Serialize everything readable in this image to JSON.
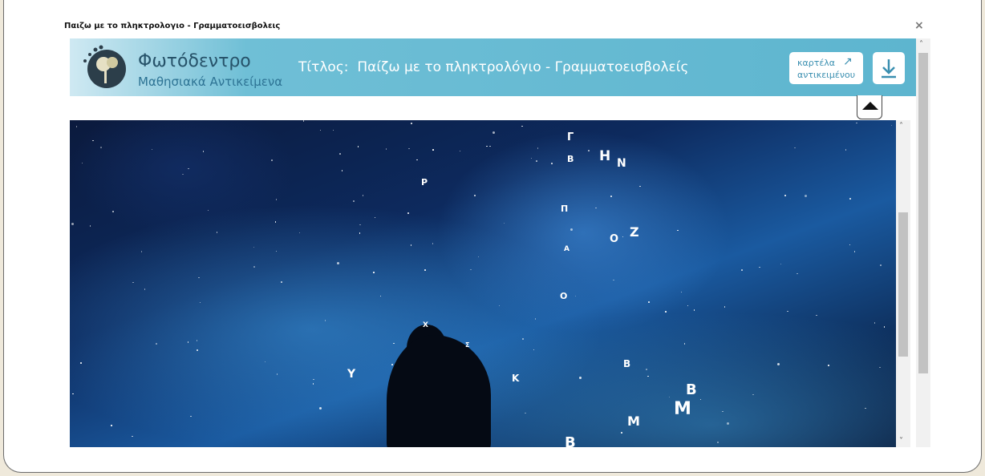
{
  "window": {
    "title": "Παιζω με το πληκτρολογιο - Γραμματοεισβολεις",
    "close_glyph": "×"
  },
  "header": {
    "brand": "Φωτόδεντρο",
    "brand_sub": "Μαθησιακά Αντικείμενα",
    "title_label": "Τίτλος:",
    "title_value": "Παίζω με το πληκτρολόγιο - Γραμματοεισβολείς",
    "tab_button_line1": "καρτέλα",
    "tab_button_line2": "αντικειμένου",
    "tab_button_icon": "external-arrow-icon",
    "download_icon": "download-icon",
    "colors": {
      "bar": "#5db5cf",
      "brand": "#27536a"
    }
  },
  "game": {
    "letters": [
      {
        "char": "Γ",
        "size": 13
      },
      {
        "char": "Β",
        "size": 11
      },
      {
        "char": "Η",
        "size": 17
      },
      {
        "char": "Ν",
        "size": 14
      },
      {
        "char": "Ρ",
        "size": 11
      },
      {
        "char": "Π",
        "size": 11
      },
      {
        "char": "Ζ",
        "size": 16
      },
      {
        "char": "Ο",
        "size": 13
      },
      {
        "char": "Α",
        "size": 9
      },
      {
        "char": "Ο",
        "size": 11
      },
      {
        "char": "Χ",
        "size": 9
      },
      {
        "char": "Σ",
        "size": 8
      },
      {
        "char": "Υ",
        "size": 14
      },
      {
        "char": "Κ",
        "size": 12
      },
      {
        "char": "Β",
        "size": 12
      },
      {
        "char": "Β",
        "size": 18
      },
      {
        "char": "Μ",
        "size": 22
      },
      {
        "char": "Μ",
        "size": 16
      },
      {
        "char": "Β",
        "size": 18
      }
    ]
  }
}
